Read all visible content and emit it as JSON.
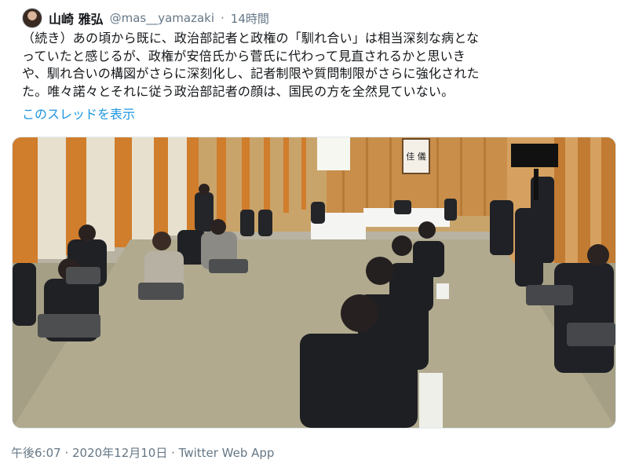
{
  "tweet": {
    "author_name": "山崎 雅弘",
    "handle": "@mas__yamazaki",
    "separator": "·",
    "time_ago": "14時間",
    "text_lines": [
      "（続き）あの頃から既に、政治部記者と政権の「馴れ合い」は相当深刻な病とな",
      "っていたと感じるが、政権が安倍氏から菅氏に代わって見直されるかと思いき",
      "や、馴れ合いの構図がさらに深刻化し、記者制限や質問制限がさらに強化された",
      "た。唯々諾々とそれに従う政治部記者の顔は、国民の方を全然見ていない。"
    ],
    "thread_link": "このスレッドを表示",
    "footer": "午後6:07 · 2020年12月10日 · Twitter Web App",
    "photo_sign": "佳 儀"
  },
  "icons": {
    "avatar": "user-avatar",
    "photo": "press-conference-photo"
  }
}
